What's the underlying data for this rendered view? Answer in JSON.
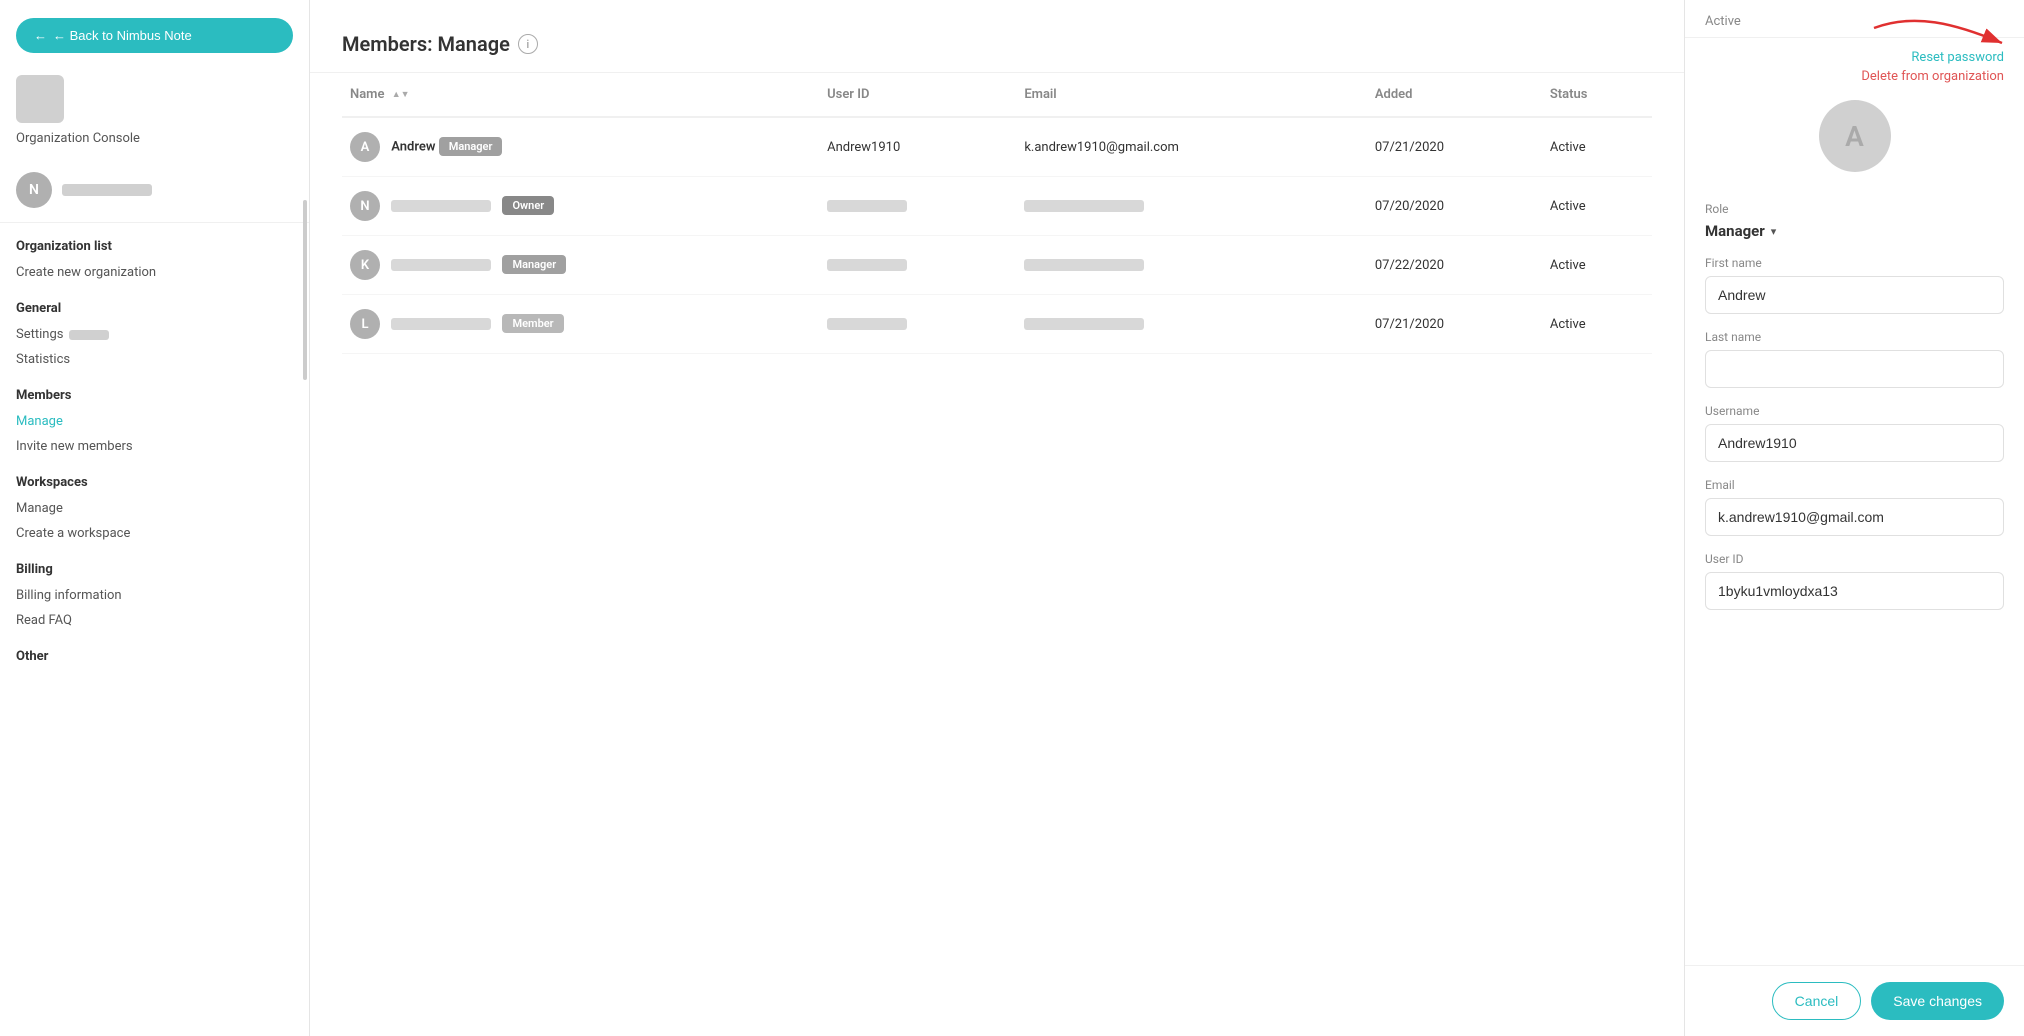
{
  "sidebar": {
    "back_button": "← Back to Nimbus Note",
    "org_label": "Organization Console",
    "user_initial": "N",
    "sections": [
      {
        "title": "Organization list",
        "links": [
          {
            "label": "Create new organization",
            "active": false
          }
        ]
      },
      {
        "title": "General",
        "links": [
          {
            "label": "Settings",
            "active": false
          },
          {
            "label": "Statistics",
            "active": false
          }
        ]
      },
      {
        "title": "Members",
        "links": [
          {
            "label": "Manage",
            "active": true
          },
          {
            "label": "Invite new members",
            "active": false
          }
        ]
      },
      {
        "title": "Workspaces",
        "links": [
          {
            "label": "Manage",
            "active": false
          },
          {
            "label": "Create a workspace",
            "active": false
          }
        ]
      },
      {
        "title": "Billing",
        "links": [
          {
            "label": "Billing information",
            "active": false
          },
          {
            "label": "Read FAQ",
            "active": false
          }
        ]
      },
      {
        "title": "Other",
        "links": []
      }
    ]
  },
  "main": {
    "title": "Members: Manage",
    "columns": [
      "Name",
      "User ID",
      "Email",
      "Added",
      "Status"
    ],
    "members": [
      {
        "initial": "A",
        "name": "Andrew",
        "role": "Manager",
        "user_id": "Andrew1910",
        "email": "k.andrew1910@gmail.com",
        "added": "07/21/2020",
        "status": "Active",
        "avatar_color": "gray"
      },
      {
        "initial": "N",
        "name": "",
        "role": "Owner",
        "user_id": "",
        "email": "",
        "added": "07/20/2020",
        "status": "Active",
        "avatar_color": "gray"
      },
      {
        "initial": "K",
        "name": "",
        "role": "Manager",
        "user_id": "",
        "email": "",
        "added": "07/22/2020",
        "status": "Active",
        "avatar_color": "gray"
      },
      {
        "initial": "L",
        "name": "",
        "role": "Member",
        "user_id": "",
        "email": "",
        "added": "07/21/2020",
        "status": "Active",
        "avatar_color": "gray"
      }
    ]
  },
  "panel": {
    "active_label": "Active",
    "reset_password": "Reset password",
    "delete_from_org": "Delete from organization",
    "avatar_initial": "A",
    "role_label": "Role",
    "role_value": "Manager",
    "first_name_label": "First name",
    "first_name_value": "Andrew",
    "last_name_label": "Last name",
    "last_name_value": "",
    "username_label": "Username",
    "username_value": "Andrew1910",
    "email_label": "Email",
    "email_value": "k.andrew1910@gmail.com",
    "user_id_label": "User ID",
    "user_id_value": "1byku1vmloydxa13",
    "cancel_label": "Cancel",
    "save_label": "Save changes"
  }
}
